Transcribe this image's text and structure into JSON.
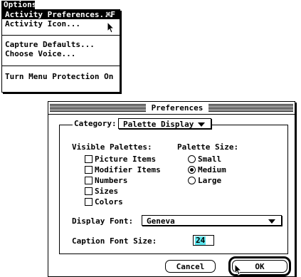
{
  "menu": {
    "title": "Options",
    "items": [
      {
        "label": "Activity Preferences...",
        "shortcut": "⌘F"
      },
      {
        "label": "Activity Icon..."
      },
      {
        "label": "Capture Defaults..."
      },
      {
        "label": "Choose Voice..."
      },
      {
        "label": "Turn Menu Protection On"
      }
    ]
  },
  "dialog": {
    "title": "Preferences",
    "category_label": "Category:",
    "category_value": "Palette Display",
    "visible_palettes_label": "Visible Palettes:",
    "palettes": [
      {
        "label": "Picture Items",
        "checked": false
      },
      {
        "label": "Modifier Items",
        "checked": false
      },
      {
        "label": "Numbers",
        "checked": false
      },
      {
        "label": "Sizes",
        "checked": false
      },
      {
        "label": "Colors",
        "checked": false
      }
    ],
    "palette_size_label": "Palette Size:",
    "sizes": [
      {
        "label": "Small",
        "selected": false
      },
      {
        "label": "Medium",
        "selected": true
      },
      {
        "label": "Large",
        "selected": false
      }
    ],
    "display_font_label": "Display Font:",
    "display_font_value": "Geneva",
    "caption_font_size_label": "Caption Font Size:",
    "caption_font_size_value": "24",
    "cancel_label": "Cancel",
    "ok_label": "OK"
  },
  "colors": {
    "highlight": "#5ce6ee"
  }
}
